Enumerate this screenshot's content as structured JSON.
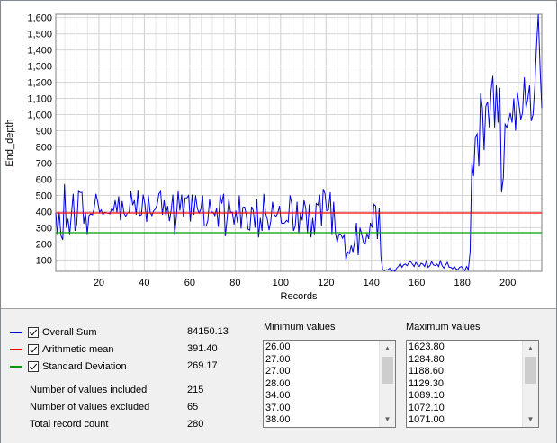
{
  "chart_data": {
    "type": "line",
    "xlabel": "Records",
    "ylabel": "End_depth",
    "xlim": [
      1,
      215
    ],
    "ylim": [
      30,
      1620
    ],
    "x_ticks": [
      20,
      40,
      60,
      80,
      100,
      120,
      140,
      160,
      180,
      200
    ],
    "y_ticks": [
      100,
      200,
      300,
      400,
      500,
      600,
      700,
      800,
      900,
      1000,
      1100,
      1200,
      1300,
      1400,
      1500,
      1600
    ],
    "y_tick_labels": [
      "100",
      "200",
      "300",
      "400",
      "500",
      "600",
      "700",
      "800",
      "900",
      "1,000",
      "1,100",
      "1,200",
      "1,300",
      "1,400",
      "1,500",
      "1,600"
    ],
    "grid": true,
    "series": [
      {
        "color": "#0000e0",
        "values": [
          390,
          260,
          395,
          252,
          225,
          570,
          300,
          355,
          260,
          390,
          510,
          280,
          320,
          525,
          518,
          520,
          325,
          395,
          260,
          375,
          385,
          380,
          420,
          510,
          460,
          395,
          410,
          380,
          395,
          392,
          390,
          385,
          420,
          405,
          470,
          395,
          495,
          345,
          465,
          390,
          370,
          390,
          395,
          525,
          440,
          470,
          380,
          530,
          375,
          380,
          505,
          445,
          335,
          500,
          395,
          375,
          405,
          415,
          445,
          510,
          525,
          380,
          470,
          375,
          435,
          340,
          408,
          505,
          262,
          365,
          525,
          405,
          505,
          370,
          485,
          485,
          500,
          338,
          505,
          380,
          500,
          420,
          390,
          415,
          500,
          310,
          310,
          345,
          475,
          395,
          395,
          375,
          420,
          305,
          505,
          450,
          510,
          248,
          355,
          475,
          395,
          395,
          320,
          405,
          330,
          500,
          295,
          425,
          428,
          380,
          290,
          285,
          430,
          405,
          300,
          480,
          240,
          360,
          280,
          510,
          390,
          355,
          285,
          340,
          460,
          380,
          370,
          390,
          435,
          330,
          325,
          330,
          345,
          335,
          500,
          450,
          280,
          310,
          460,
          265,
          390,
          345,
          470,
          420,
          265,
          445,
          240,
          360,
          260,
          450,
          440,
          505,
          310,
          540,
          510,
          405,
          410,
          520,
          260,
          460,
          265,
          210,
          260,
          260,
          235,
          255,
          100,
          150,
          140,
          190,
          150,
          220,
          330,
          130,
          300,
          260,
          210,
          200,
          265,
          230,
          330,
          300,
          445,
          435,
          230,
          425,
          120,
          40,
          35,
          40,
          40,
          50,
          30,
          40,
          30,
          50,
          60,
          80,
          55,
          70,
          75,
          65,
          85,
          90,
          75,
          60,
          85,
          70,
          60,
          80,
          75,
          60,
          95,
          55,
          65,
          90,
          70,
          65,
          75,
          60,
          95,
          65,
          50,
          70,
          85,
          55,
          55,
          45,
          60,
          45,
          40,
          55,
          60,
          45,
          35,
          60,
          40,
          150,
          700,
          620,
          860,
          880,
          680,
          1130,
          1040,
          780,
          1050,
          1080,
          920,
          1150,
          1240,
          920,
          1180,
          950,
          1165,
          520,
          610,
          940,
          920,
          960,
          1010,
          950,
          1100,
          900,
          1140,
          1060,
          970,
          1010,
          1230,
          1040,
          1100,
          1180,
          960,
          1000,
          1170,
          1430,
          1620,
          1290,
          1040
        ]
      },
      {
        "color": "#ff0000",
        "values": [
          391.4,
          391.4
        ],
        "x": [
          1,
          215
        ]
      },
      {
        "color": "#00a000",
        "values": [
          269.17,
          269.17
        ],
        "x": [
          1,
          215
        ]
      }
    ]
  },
  "stats": {
    "legend": [
      {
        "label": "Overall Sum",
        "value": "84150.13",
        "color": "#0000e0",
        "checked": true
      },
      {
        "label": "Arithmetic mean",
        "value": "391.40",
        "color": "#ff0000",
        "checked": true
      },
      {
        "label": "Standard Deviation",
        "value": "269.17",
        "color": "#00a000",
        "checked": true
      }
    ],
    "info": [
      {
        "label": "Number of values included",
        "value": "215"
      },
      {
        "label": "Number of  values excluded",
        "value": "65"
      },
      {
        "label": "Total record count",
        "value": "280"
      }
    ]
  },
  "min_values": {
    "title": "Minimum values",
    "items": [
      "26.00",
      "27.00",
      "27.00",
      "28.00",
      "34.00",
      "37.00",
      "38.00"
    ]
  },
  "max_values": {
    "title": "Maximum values",
    "items": [
      "1623.80",
      "1284.80",
      "1188.60",
      "1129.30",
      "1089.10",
      "1072.10",
      "1071.00"
    ]
  }
}
